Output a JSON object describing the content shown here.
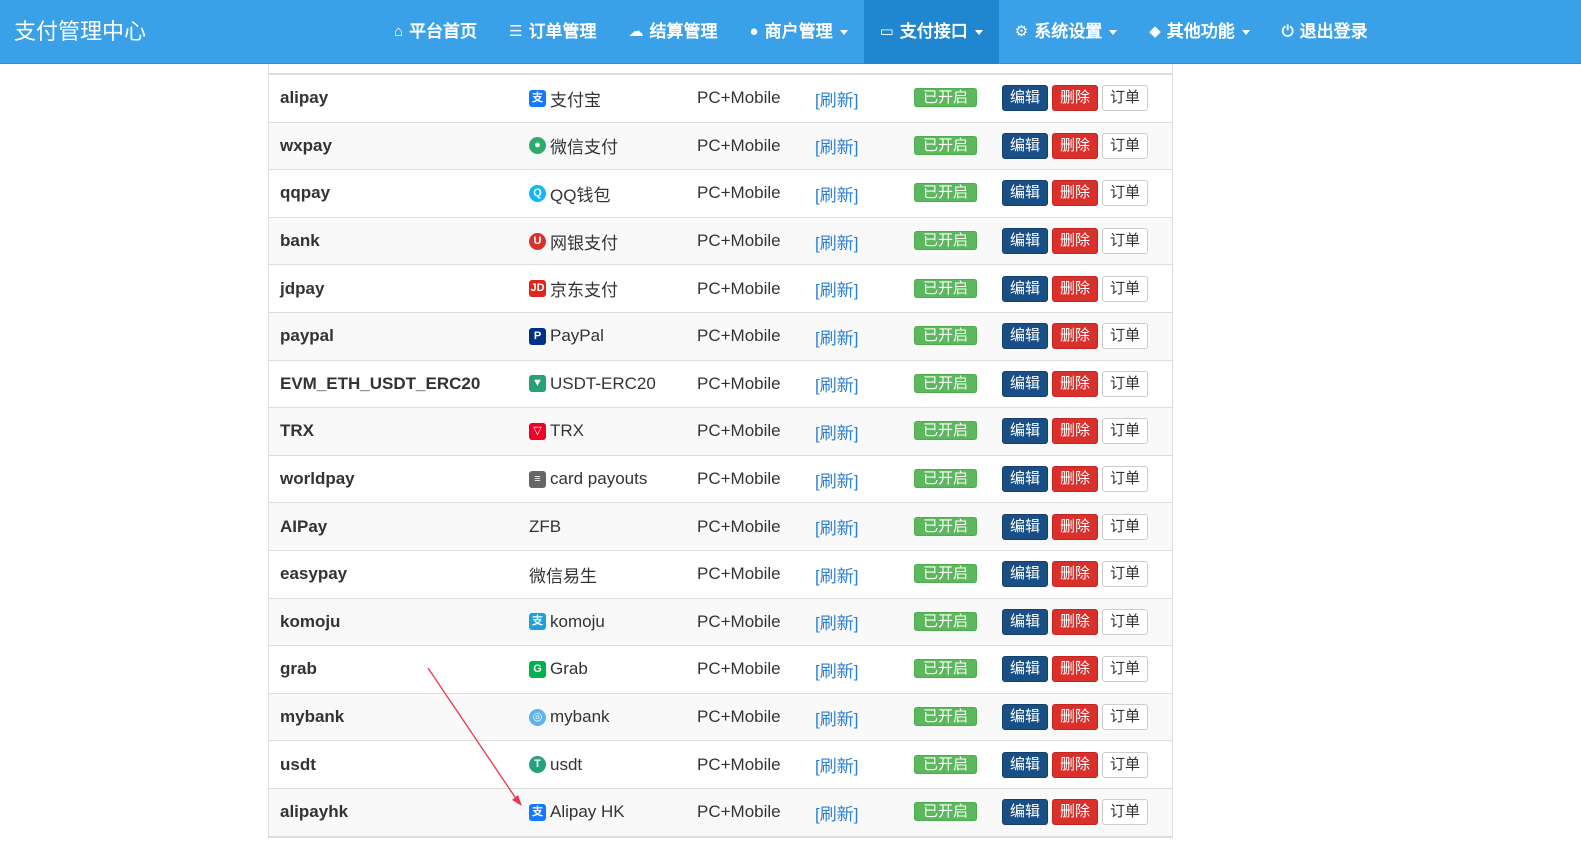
{
  "brand": "支付管理中心",
  "nav": [
    {
      "label": "平台首页",
      "icon": "home-icon",
      "glyph": "⌂",
      "dropdown": false,
      "active": false
    },
    {
      "label": "订单管理",
      "icon": "list-icon",
      "glyph": "☰",
      "dropdown": false,
      "active": false
    },
    {
      "label": "结算管理",
      "icon": "cloud-icon",
      "glyph": "☁",
      "dropdown": false,
      "active": false
    },
    {
      "label": "商户管理",
      "icon": "user-icon",
      "glyph": "●",
      "dropdown": true,
      "active": false
    },
    {
      "label": "支付接口",
      "icon": "credit-card-icon",
      "glyph": "▭",
      "dropdown": true,
      "active": true
    },
    {
      "label": "系统设置",
      "icon": "gear-icon",
      "glyph": "⚙",
      "dropdown": true,
      "active": false
    },
    {
      "label": "其他功能",
      "icon": "cube-icon",
      "glyph": "◆",
      "dropdown": true,
      "active": false
    },
    {
      "label": "退出登录",
      "icon": "power-icon",
      "glyph": "⏻",
      "dropdown": false,
      "active": false
    }
  ],
  "labels": {
    "device": "PC+Mobile",
    "refresh": "[刷新]",
    "status": "已开启",
    "edit": "编辑",
    "delete": "删除",
    "order": "订单"
  },
  "rows": [
    {
      "code": "alipay",
      "name": "支付宝",
      "icon": "alipay-icon",
      "icon_text": "支",
      "icon_color": "#1677ff"
    },
    {
      "code": "wxpay",
      "name": "微信支付",
      "icon": "wechat-icon",
      "icon_text": "●",
      "icon_color": "#2aae67"
    },
    {
      "code": "qqpay",
      "name": "QQ钱包",
      "icon": "qq-icon",
      "icon_text": "Q",
      "icon_color": "#12b7f5"
    },
    {
      "code": "bank",
      "name": "网银支付",
      "icon": "bank-icon",
      "icon_text": "U",
      "icon_color": "#d9302c"
    },
    {
      "code": "jdpay",
      "name": "京东支付",
      "icon": "jd-icon",
      "icon_text": "JD",
      "icon_color": "#e1251b"
    },
    {
      "code": "paypal",
      "name": "PayPal",
      "icon": "paypal-icon",
      "icon_text": "P",
      "icon_color": "#003087"
    },
    {
      "code": "EVM_ETH_USDT_ERC20",
      "name": "USDT-ERC20",
      "icon": "tether-icon",
      "icon_text": "▼",
      "icon_color": "#26a17b"
    },
    {
      "code": "TRX",
      "name": "TRX",
      "icon": "tron-icon",
      "icon_text": "▽",
      "icon_color": "#ef0027"
    },
    {
      "code": "worldpay",
      "name": "card payouts",
      "icon": "worldpay-icon",
      "icon_text": "≡",
      "icon_color": "#666666"
    },
    {
      "code": "AIPay",
      "name": "ZFB",
      "icon": "",
      "icon_text": "",
      "icon_color": ""
    },
    {
      "code": "easypay",
      "name": "微信易生",
      "icon": "",
      "icon_text": "",
      "icon_color": ""
    },
    {
      "code": "komoju",
      "name": "komoju",
      "icon": "komoju-icon",
      "icon_text": "支",
      "icon_color": "#1ba0e2"
    },
    {
      "code": "grab",
      "name": "Grab",
      "icon": "grab-icon",
      "icon_text": "G",
      "icon_color": "#00b14f"
    },
    {
      "code": "mybank",
      "name": "mybank",
      "icon": "mybank-icon",
      "icon_text": "◎",
      "icon_color": "#5ab4f0"
    },
    {
      "code": "usdt",
      "name": "usdt",
      "icon": "usdt-icon",
      "icon_text": "T",
      "icon_color": "#26a17b"
    },
    {
      "code": "alipayhk",
      "name": "Alipay HK",
      "icon": "alipay-hk-icon",
      "icon_text": "支",
      "icon_color": "#1677ff"
    }
  ],
  "colors": {
    "navbar": "#3aa0e8",
    "nav_active": "#1f86cf",
    "status_green": "#5cb85c",
    "edit_blue": "#1a4f86",
    "delete_red": "#d9302c",
    "link_blue": "#2a7fd6",
    "annotation_arrow": "#e8384f"
  }
}
